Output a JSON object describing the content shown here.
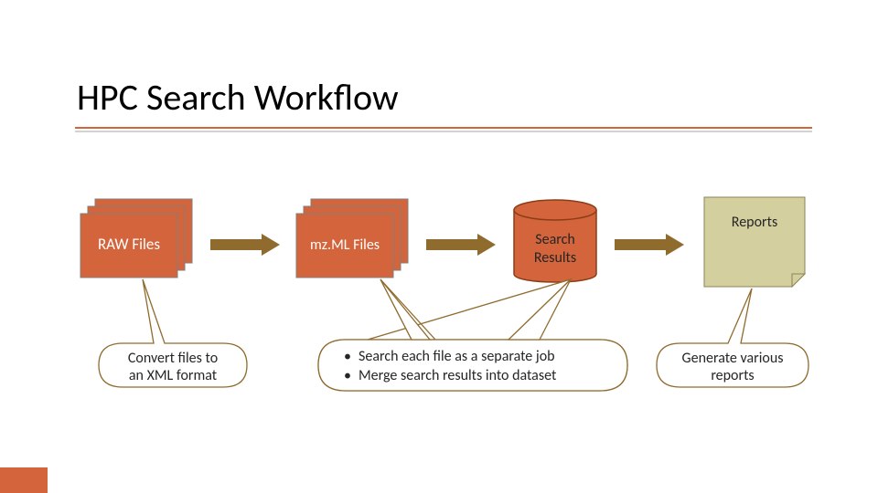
{
  "slide": {
    "title": "HPC Search Workflow"
  },
  "nodes": {
    "raw": {
      "label": "RAW Files"
    },
    "mzml": {
      "label": "mz.ML Files"
    },
    "results": {
      "label_l1": "Search",
      "label_l2": "Results"
    },
    "reports": {
      "label": "Reports"
    }
  },
  "callouts": {
    "convert": {
      "line1": "Convert files to",
      "line2": "an XML format"
    },
    "search": {
      "bullet1": "Search each file as a separate job",
      "bullet2": "Merge search results into dataset"
    },
    "generate": {
      "line1": "Generate various",
      "line2": "reports"
    }
  },
  "colors": {
    "accent": "#d3643b",
    "arrow": "#8f6b2d",
    "note_fill": "#d4cf9f",
    "note_stroke": "#8c8554"
  }
}
